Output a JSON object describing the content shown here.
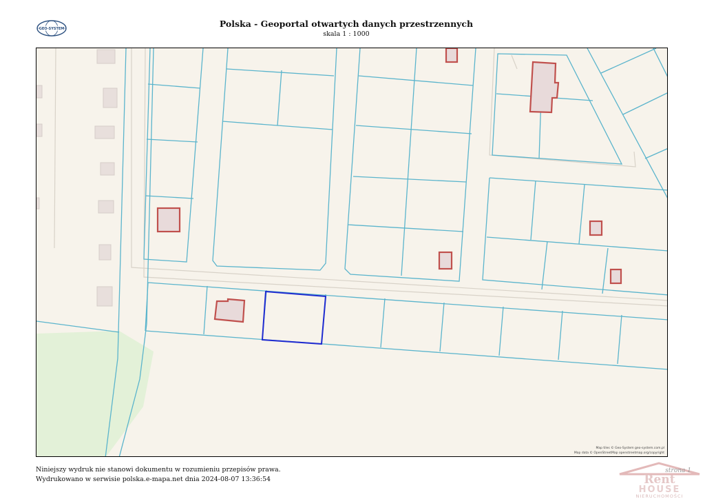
{
  "header": {
    "title": "Polska - Geoportal otwartych danych przestrzennych",
    "scale": "skala 1 : 1000",
    "logo_text": "GEO-SYSTEM"
  },
  "map": {
    "attribution_1": "Map tiles © Geo-System geo-system.com.pl",
    "attribution_2": "Map data © OpenStreetMap openstreetmap.org/copyright",
    "colors": {
      "background": "#f7f3eb",
      "parcel_line": "#5ab4cc",
      "building_fill": "#e8dada",
      "building_outline": "#c0504d",
      "selected_parcel": "#1f2bd0",
      "green_area": "#e3f1d8"
    }
  },
  "footer": {
    "line1": "Niniejszy wydruk nie stanowi dokumentu w rozumieniu przepisów prawa.",
    "line2": "Wydrukowano w serwisie polska.e-mapa.net dnia 2024-08-07 13:36:54"
  },
  "watermark": {
    "page_label": "strona 1",
    "brand_line1": "Rent",
    "brand_line2": "HOUSE",
    "brand_line3": "NIERUCHOMOŚCI"
  }
}
